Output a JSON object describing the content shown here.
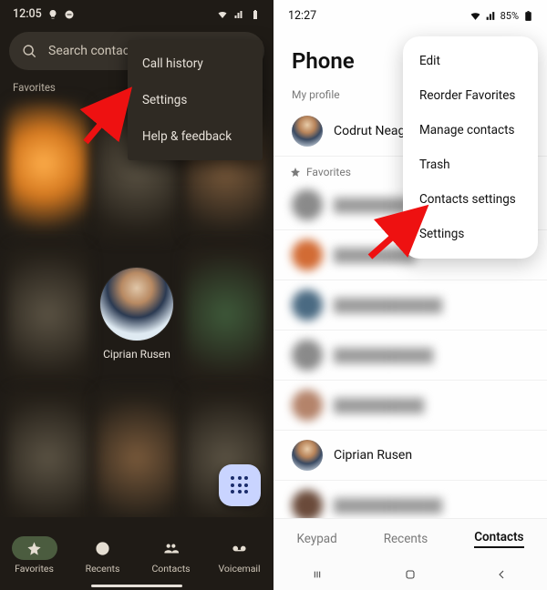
{
  "left": {
    "status": {
      "time": "12:05",
      "icons": [
        "lightbulb-icon",
        "dnd-icon",
        "wifi-icon",
        "signal-icon",
        "battery-icon"
      ]
    },
    "search": {
      "placeholder": "Search contacts"
    },
    "favorites_label": "Favorites",
    "visible_contact": {
      "name": "Ciprian Rusen"
    },
    "menu": {
      "items": [
        {
          "label": "Call history"
        },
        {
          "label": "Settings"
        },
        {
          "label": "Help & feedback"
        }
      ]
    },
    "bottom_nav": {
      "items": [
        {
          "label": "Favorites",
          "icon": "star-icon",
          "active": true
        },
        {
          "label": "Recents",
          "icon": "clock-icon"
        },
        {
          "label": "Contacts",
          "icon": "people-icon"
        },
        {
          "label": "Voicemail",
          "icon": "voicemail-icon"
        }
      ]
    }
  },
  "right": {
    "status": {
      "time": "12:27",
      "battery_pct": "85%"
    },
    "title": "Phone",
    "profile_label": "My profile",
    "profile_name": "Codrut Neagu",
    "favorites_label": "Favorites",
    "visible_contact": {
      "name": "Ciprian Rusen"
    },
    "menu": {
      "items": [
        {
          "label": "Edit"
        },
        {
          "label": "Reorder Favorites"
        },
        {
          "label": "Manage contacts"
        },
        {
          "label": "Trash"
        },
        {
          "label": "Contacts settings"
        },
        {
          "label": "Settings"
        }
      ]
    },
    "tabs": {
      "items": [
        {
          "label": "Keypad"
        },
        {
          "label": "Recents"
        },
        {
          "label": "Contacts",
          "active": true
        }
      ]
    }
  }
}
